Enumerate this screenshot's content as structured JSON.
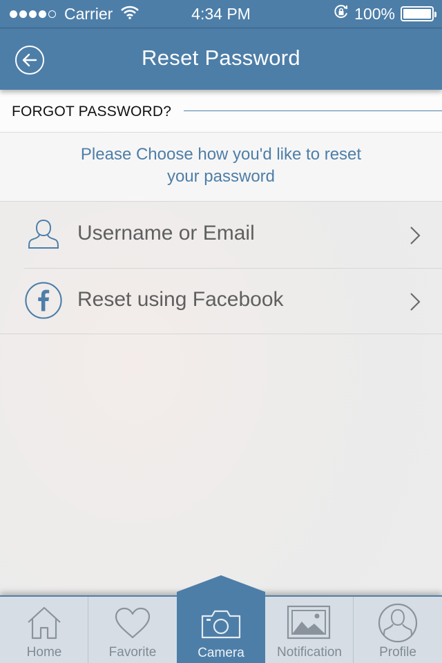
{
  "status_bar": {
    "carrier": "Carrier",
    "time": "4:34 PM",
    "battery": "100%",
    "signal_bars": 4
  },
  "nav": {
    "title": "Reset Password",
    "back_icon": "back-arrow-icon"
  },
  "section": {
    "title": "FORGOT PASSWORD?"
  },
  "intro": {
    "text": "Please Choose how you'd like to reset your password"
  },
  "options": [
    {
      "label": "Username or Email",
      "icon": "user-icon"
    },
    {
      "label": "Reset using Facebook",
      "icon": "facebook-icon"
    }
  ],
  "tabs": [
    {
      "label": "Home",
      "icon": "home-icon"
    },
    {
      "label": "Favorite",
      "icon": "heart-icon"
    },
    {
      "label": "Camera",
      "icon": "camera-icon",
      "active": true
    },
    {
      "label": "Notification",
      "icon": "image-icon"
    },
    {
      "label": "Profile",
      "icon": "profile-icon"
    }
  ],
  "colors": {
    "primary": "#4d7ea8",
    "tabbar_bg": "#d6dde5",
    "text_gray": "#5f5f5f"
  }
}
